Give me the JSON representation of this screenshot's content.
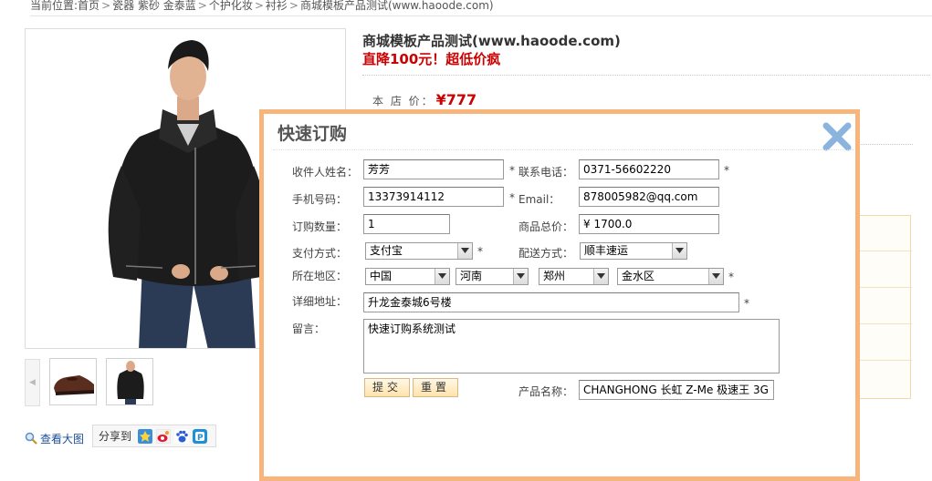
{
  "breadcrumb": {
    "label": "当前位置:",
    "items": [
      "首页",
      "瓷器 紫砂 金泰蓝",
      "个护化妆",
      "衬衫",
      "商城模板产品测试(www.haoode.com)"
    ],
    "separator": ">"
  },
  "product": {
    "title": "商城模板产品测试(www.haoode.com)",
    "promo": "直降100元！超低价疯",
    "price_label": "本 店 价：",
    "price_value": "¥777"
  },
  "gallery": {
    "view_large": "查看大图",
    "share_label": "分享到",
    "prev_arrow": "◀"
  },
  "modal": {
    "title": "快速订购",
    "required_mark": "*",
    "labels": {
      "name": "收件人姓名：",
      "phone": "联系电话：",
      "mobile": "手机号码：",
      "email": "Email：",
      "qty": "订购数量：",
      "total": "商品总价：",
      "payment": "支付方式：",
      "shipping": "配送方式：",
      "region": "所在地区：",
      "address": "详细地址：",
      "message": "留言：",
      "product_name": "产品名称："
    },
    "values": {
      "name": "芳芳",
      "phone": "0371-56602220",
      "mobile": "13373914112",
      "email": "878005982@qq.com",
      "qty": "1",
      "total": "¥ 1700.0",
      "payment": "支付宝",
      "shipping": "顺丰速运",
      "country": "中国",
      "province": "河南",
      "city": "郑州",
      "district": "金水区",
      "address": "升龙金泰城6号楼",
      "message": "快速订购系统测试",
      "product_name": "CHANGHONG 长虹 Z-Me 极速王 3G"
    },
    "buttons": {
      "submit": "提交",
      "reset": "重置"
    }
  },
  "colors": {
    "modal_border": "#f7b57c",
    "price_red": "#cc0000",
    "close_icon": "#8ab4de"
  }
}
